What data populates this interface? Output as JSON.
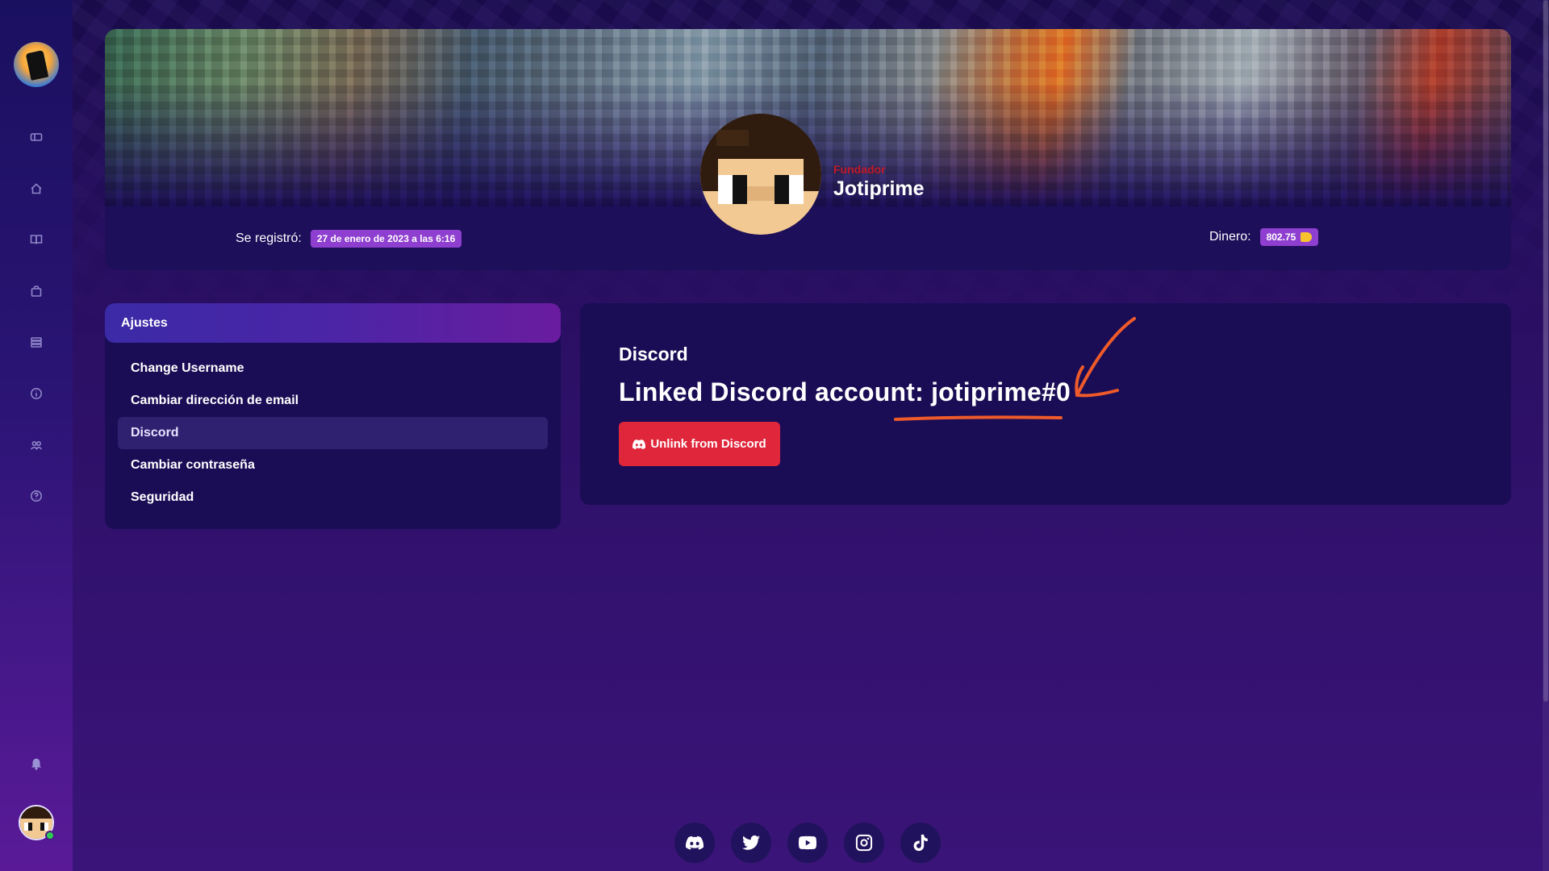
{
  "profile": {
    "rank": "Fundador",
    "username": "Jotiprime",
    "registered_label": "Se registró:",
    "registered_value": "27 de enero de 2023 a las 6:16",
    "money_label": "Dinero:",
    "money_value": "802.75"
  },
  "settings": {
    "header": "Ajustes",
    "items": [
      {
        "label": "Change Username"
      },
      {
        "label": "Cambiar dirección de email"
      },
      {
        "label": "Discord"
      },
      {
        "label": "Cambiar contraseña"
      },
      {
        "label": "Seguridad"
      }
    ],
    "active": "Discord"
  },
  "discord": {
    "title": "Discord",
    "linked_text": "Linked Discord account: jotiprime#0",
    "unlink_label": "Unlink from Discord"
  },
  "sidebar": {
    "icons": [
      "ticket-icon",
      "home-icon",
      "book-icon",
      "shop-icon",
      "list-icon",
      "info-icon",
      "users-icon",
      "help-icon"
    ]
  },
  "socials": [
    "discord-icon",
    "twitter-icon",
    "youtube-icon",
    "instagram-icon",
    "tiktok-icon"
  ],
  "colors": {
    "accent": "#8e3fcf",
    "danger": "#e0263b",
    "annotation": "#ef5a2a"
  }
}
